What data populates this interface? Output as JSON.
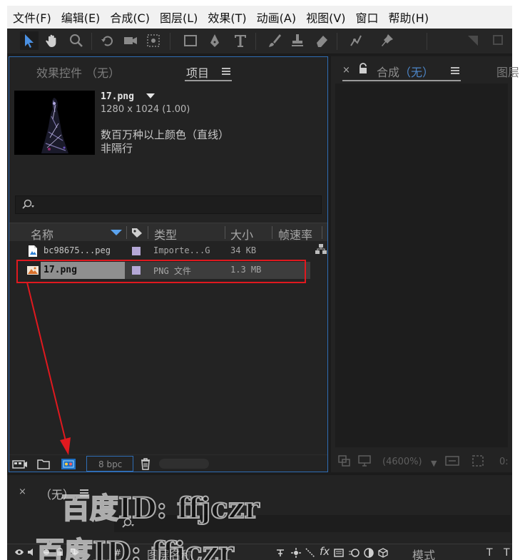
{
  "menu": [
    "文件(F)",
    "编辑(E)",
    "合成(C)",
    "图层(L)",
    "效果(T)",
    "动画(A)",
    "视图(V)",
    "窗口",
    "帮助(H)"
  ],
  "toolbar": {
    "tools": [
      "selection-tool",
      "hand-tool",
      "zoom-tool",
      "rotate-tool",
      "camera-tool",
      "pan-behind-tool",
      "rectangle-tool",
      "pen-tool",
      "type-tool",
      "brush-tool",
      "clone-stamp-tool",
      "eraser-tool",
      "roto-brush-tool",
      "puppet-pin-tool"
    ]
  },
  "project_panel": {
    "tab_effects": "效果控件 （无）",
    "tab_project": "项目",
    "preview": {
      "filename": "17.png",
      "dimensions": "1280 x 1024 (1.00)",
      "color": "数百万种以上颜色（直线）",
      "interlace": "非隔行"
    },
    "search_placeholder": "",
    "columns": {
      "name": "名称",
      "type": "类型",
      "size": "大小",
      "fps": "帧速率"
    },
    "items": [
      {
        "name": "bc98675...peg",
        "type": "Importe...G",
        "size": "34 KB",
        "label_color": "#b4a7d6",
        "selected": false
      },
      {
        "name": "17.png",
        "type": "PNG 文件",
        "size": "1.3 MB",
        "label_color": "#b4a7d6",
        "selected": true
      }
    ],
    "footer": {
      "bpc": "8 bpc"
    }
  },
  "comp_panel": {
    "close": "×",
    "tab_prefix": "合成",
    "tab_value": "（无）",
    "tab2": "图层",
    "zoom": "(4600%)",
    "time_partial": "0:"
  },
  "timeline": {
    "close": "×",
    "title": "（无）",
    "col_layer_name": "图层名称",
    "col_mode": "模式",
    "t_label": "T"
  },
  "watermark": {
    "line1": "百度ID: ffjczr",
    "line2": "百度ID: ffjczr"
  },
  "colors": {
    "accent_blue": "#2f6db5",
    "highlight_red": "#e0191f",
    "label_lavender": "#b4a7d6"
  }
}
